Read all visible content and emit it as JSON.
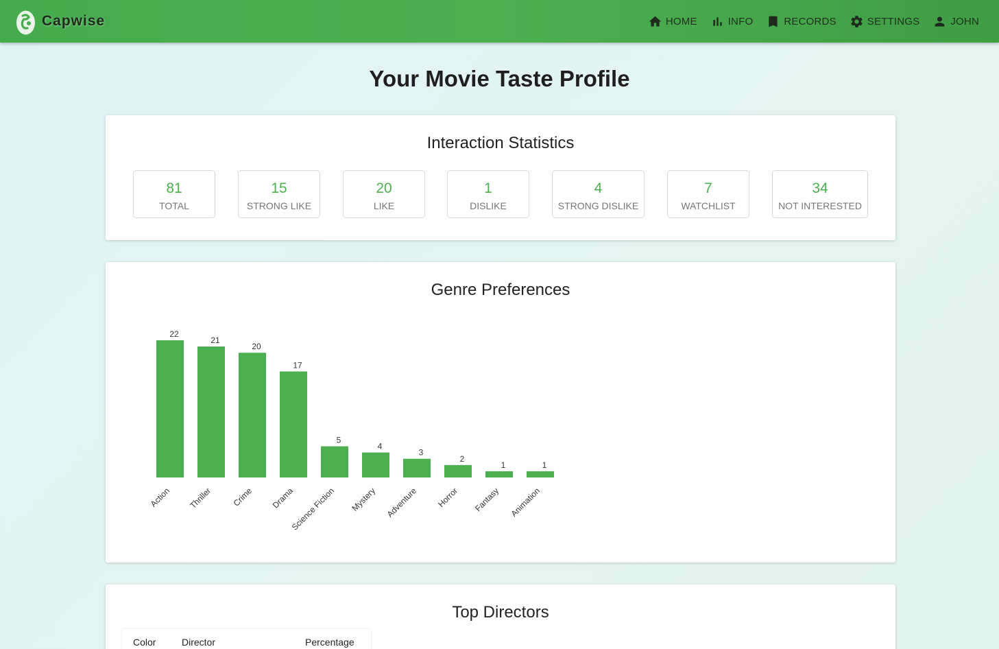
{
  "app": {
    "name": "Capwise",
    "nav": [
      {
        "label": "HOME",
        "icon": "home-icon"
      },
      {
        "label": "INFO",
        "icon": "bar-chart-icon"
      },
      {
        "label": "RECORDS",
        "icon": "bookmark-icon"
      },
      {
        "label": "SETTINGS",
        "icon": "gear-icon"
      },
      {
        "label": "JOHN",
        "icon": "person-icon"
      }
    ],
    "accent": "#4caf50"
  },
  "page": {
    "title": "Your Movie Taste Profile"
  },
  "stats": {
    "title": "Interaction Statistics",
    "items": [
      {
        "value": "81",
        "label": "TOTAL"
      },
      {
        "value": "15",
        "label": "STRONG LIKE"
      },
      {
        "value": "20",
        "label": "LIKE"
      },
      {
        "value": "1",
        "label": "DISLIKE"
      },
      {
        "value": "4",
        "label": "STRONG DISLIKE"
      },
      {
        "value": "7",
        "label": "WATCHLIST"
      },
      {
        "value": "34",
        "label": "NOT INTERESTED"
      }
    ]
  },
  "genres": {
    "title": "Genre Preferences"
  },
  "chart_data": {
    "type": "bar",
    "title": "Genre Preferences",
    "categories": [
      "Action",
      "Thriller",
      "Crime",
      "Drama",
      "Science Fiction",
      "Mystery",
      "Adventure",
      "Horror",
      "Fantasy",
      "Animation"
    ],
    "values": [
      22,
      21,
      20,
      17,
      5,
      4,
      3,
      2,
      1,
      1
    ],
    "xlabel": "",
    "ylabel": "",
    "ylim": [
      0,
      22
    ],
    "grid": false,
    "color": "#4caf50"
  },
  "directors": {
    "title": "Top Directors",
    "columns": [
      "Color",
      "Director",
      "Percentage"
    ]
  }
}
